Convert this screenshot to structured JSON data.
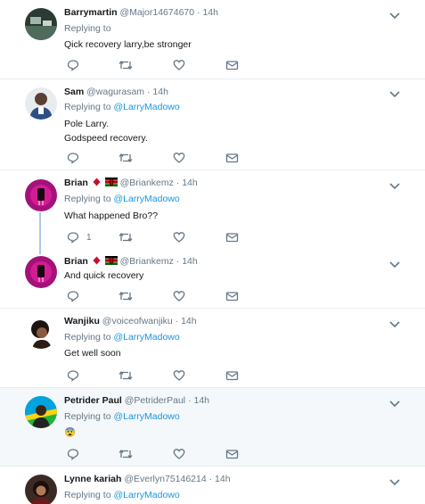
{
  "tweets": [
    {
      "name": "Barrymartin",
      "handle": "@Major14674670",
      "time": "14h",
      "replying_label": "Replying to",
      "replying_to": "",
      "lines": [
        "Qick recovery larry,be stronger"
      ],
      "reply_count": ""
    },
    {
      "name": "Sam",
      "handle": "@wagurasam",
      "time": "14h",
      "replying_label": "Replying to",
      "replying_to": "@LarryMadowo",
      "lines": [
        "Pole Larry.",
        "Godspeed recovery."
      ],
      "reply_count": ""
    },
    {
      "name": "Brian",
      "handle": "@Briankemz",
      "time": "14h",
      "replying_label": "Replying to",
      "replying_to": "@LarryMadowo",
      "lines": [
        "What happened Bro??"
      ],
      "reply_count": "1"
    },
    {
      "name": "Brian",
      "handle": "@Briankemz",
      "time": "14h",
      "lines": [
        "And quick recovery"
      ],
      "reply_count": ""
    },
    {
      "name": "Wanjiku",
      "handle": "@voiceofwanjiku",
      "time": "14h",
      "replying_label": "Replying to",
      "replying_to": "@LarryMadowo",
      "lines": [
        "Get well soon"
      ],
      "reply_count": ""
    },
    {
      "name": "Petrider Paul",
      "handle": "@PetriderPaul",
      "time": "14h",
      "replying_label": "Replying to",
      "replying_to": "@LarryMadowo",
      "lines": [
        "😨"
      ],
      "reply_count": ""
    },
    {
      "name": "Lynne kariah",
      "handle": "@Everlyn75146214",
      "time": "14h",
      "replying_label": "Replying to",
      "replying_to": "@LarryMadowo",
      "lines": [],
      "reply_count": ""
    }
  ],
  "separator": " · ",
  "colors": {
    "link": "#1b95e0",
    "muted": "#657786",
    "icon": "#657786",
    "highlight": "#f5f8fa",
    "thread_line": "#aac8e8"
  },
  "icons": {
    "reply": "reply-icon",
    "retweet": "retweet-icon",
    "like": "heart-icon",
    "dm": "envelope-icon",
    "more": "chevron-down-icon",
    "badge": "red-diamond-icon",
    "flag": "kenya-flag-icon"
  }
}
